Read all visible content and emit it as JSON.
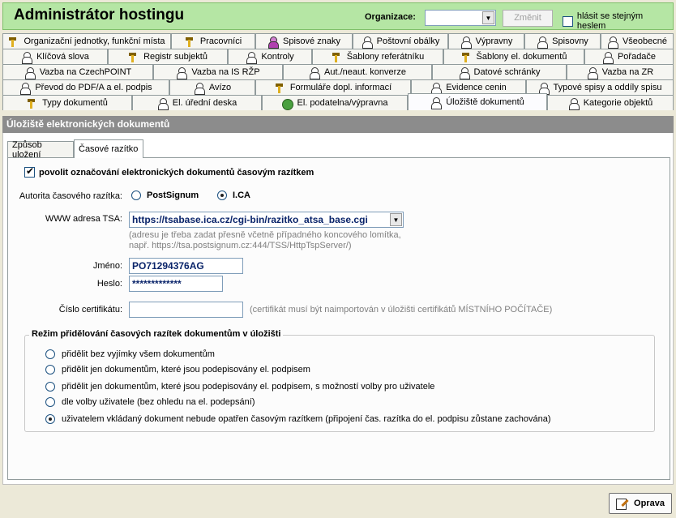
{
  "header": {
    "title": "Administrátor hostingu",
    "org_label": "Organizace:",
    "org_value": "",
    "change_label": "Změnit",
    "same_password_label": "hlásit se stejným heslem"
  },
  "tabs": {
    "row1": [
      {
        "label": "Organizační jednotky, funkční místa",
        "icon": "tool-icon"
      },
      {
        "label": "Pracovníci",
        "icon": "tool-icon"
      },
      {
        "label": "Spisové znaky",
        "icon": "person-icon"
      },
      {
        "label": "Poštovní obálky",
        "icon": "person-icon"
      },
      {
        "label": "Výpravny",
        "icon": "person-icon"
      },
      {
        "label": "Spisovny",
        "icon": "person-icon"
      },
      {
        "label": "Všeobecné",
        "icon": "person-icon"
      }
    ],
    "row2": [
      {
        "label": "Klíčová slova",
        "icon": "person-icon"
      },
      {
        "label": "Registr subjektů",
        "icon": "tool-icon"
      },
      {
        "label": "Kontroly",
        "icon": "person-icon"
      },
      {
        "label": "Šablony referátníku",
        "icon": "tool-icon"
      },
      {
        "label": "Šablony el. dokumentů",
        "icon": "tool-icon"
      },
      {
        "label": "Pořadače",
        "icon": "person-icon"
      }
    ],
    "row3": [
      {
        "label": "Vazba na CzechPOINT",
        "icon": "person-icon"
      },
      {
        "label": "Vazba na IS RŽP",
        "icon": "person-icon"
      },
      {
        "label": "Aut./neaut. konverze",
        "icon": "person-icon"
      },
      {
        "label": "Datové schránky",
        "icon": "person-icon"
      },
      {
        "label": "Vazba na ZR",
        "icon": "person-icon"
      }
    ],
    "row4": [
      {
        "label": "Převod do PDF/A a el. podpis",
        "icon": "person-icon"
      },
      {
        "label": "Avízo",
        "icon": "person-icon"
      },
      {
        "label": "Formuláře dopl. informací",
        "icon": "tool-icon"
      },
      {
        "label": "Evidence cenin",
        "icon": "person-icon"
      },
      {
        "label": "Typové spisy a oddíly spisu",
        "icon": "person-icon"
      }
    ],
    "row5": [
      {
        "label": "Typy dokumentů",
        "icon": "tool-icon"
      },
      {
        "label": "El. úřední deska",
        "icon": "person-icon"
      },
      {
        "label": "El. podatelna/výpravna",
        "icon": "globe-icon"
      },
      {
        "label": "Úložiště dokumentů",
        "icon": "person-icon"
      },
      {
        "label": "Kategorie objektů",
        "icon": "person-icon"
      }
    ]
  },
  "section_title": "Úložiště elektronických dokumentů",
  "subtabs": [
    "Způsob uložení",
    "Časové razítko"
  ],
  "form": {
    "enable_label": "povolit označování elektronických dokumentů časovým razítkem",
    "authority_label": "Autorita časového razítka:",
    "authority_options": [
      "PostSignum",
      "I.CA"
    ],
    "url_label": "WWW adresa TSA:",
    "url_value": "https://tsabase.ica.cz/cgi-bin/razitko_atsa_base.cgi",
    "url_hint_1": "(adresu je třeba zadat přesně včetně případného koncového lomítka,",
    "url_hint_2": "např. https://tsa.postsignum.cz:444/TSS/HttpTspServer/)",
    "name_label": "Jméno:",
    "name_value": "PO71294376AG",
    "password_label": "Heslo:",
    "password_value": "*************",
    "cert_label": "Číslo certifikátu:",
    "cert_value": "",
    "cert_hint": "(certifikát musí být naimportován v úložišti certifikátů MÍSTNÍHO POČÍTAČE)"
  },
  "mode": {
    "title": "Režim přidělování časových razítek dokumentům v úložišti",
    "options": [
      "přidělit bez vyjímky všem dokumentům",
      "přidělit jen dokumentům, které jsou podepisovány el. podpisem",
      "přidělit jen dokumentům, které jsou podepisovány el. podpisem, s možností volby pro uživatele",
      "dle volby uživatele (bez ohledu na el. podepsání)",
      "uživatelem vkládaný dokument nebude opatřen časovým razítkem (připojení čas. razítka do el. podpisu zůstane zachována)"
    ],
    "selected_index": 4
  },
  "footer": {
    "edit_label": "Oprava"
  }
}
